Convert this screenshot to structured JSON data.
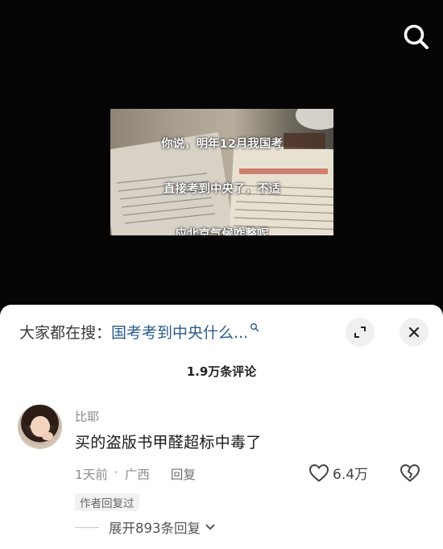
{
  "video": {
    "caption_lines": [
      "你说，明年12月我国考",
      "直接考到中央了，不适",
      "应北京气候咋整呢"
    ]
  },
  "icons": {
    "search": "search-icon",
    "expand": "expand-icon",
    "close": "close-icon",
    "heart": "heart-icon",
    "broken_heart": "broken-heart-icon",
    "chevron": "chevron-down-icon"
  },
  "sheet": {
    "search_prefix": "大家都在搜：",
    "search_query": "国考考到中央什么...",
    "comment_count": "1.9万条评论"
  },
  "comment": {
    "username": "比耶",
    "text": "买的盗版书甲醛超标中毒了",
    "time": "1天前",
    "separator": "·",
    "location": "广西",
    "reply_label": "回复",
    "like_count": "6.4万",
    "author_badge": "作者回复过",
    "expand_replies": "展开893条回复"
  },
  "colors": {
    "query_link": "#2b5c8a",
    "sheet_bg": "#ffffff",
    "video_bg": "#050505"
  }
}
